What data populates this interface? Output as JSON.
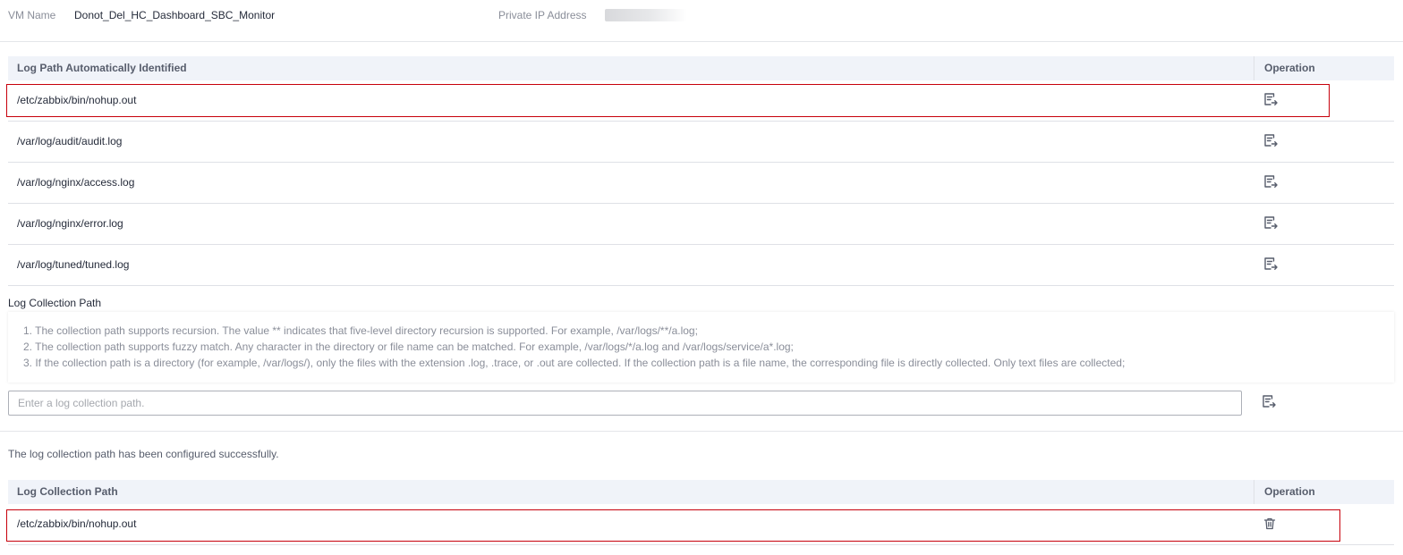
{
  "vm_info": {
    "vm_name_label": "VM Name",
    "vm_name_value": "Donot_Del_HC_Dashboard_SBC_Monitor",
    "private_ip_label": "Private IP Address"
  },
  "identified_table": {
    "headers": {
      "path": "Log Path Automatically Identified",
      "operation": "Operation"
    },
    "rows": [
      {
        "path": "/etc/zabbix/bin/nohup.out",
        "icon": "add-to-collection-icon"
      },
      {
        "path": "/var/log/audit/audit.log",
        "icon": "add-to-collection-icon"
      },
      {
        "path": "/var/log/nginx/access.log",
        "icon": "add-to-collection-icon"
      },
      {
        "path": "/var/log/nginx/error.log",
        "icon": "add-to-collection-icon"
      },
      {
        "path": "/var/log/tuned/tuned.log",
        "icon": "add-to-collection-icon"
      }
    ]
  },
  "collection": {
    "label": "Log Collection Path",
    "tips": [
      "1. The collection path supports recursion. The value ** indicates that five-level directory recursion is supported. For example, /var/logs/**/a.log;",
      "2. The collection path supports fuzzy match. Any character in the directory or file name can be matched. For example, /var/logs/*/a.log and /var/logs/service/a*.log;",
      "3. If the collection path is a directory (for example, /var/logs/), only the files with the extension .log, .trace, or .out are collected. If the collection path is a file name, the corresponding file is directly collected. Only text files are collected;"
    ],
    "input_placeholder": "Enter a log collection path.",
    "input_value": "",
    "success_message": "The log collection path has been configured successfully."
  },
  "configured_table": {
    "headers": {
      "path": "Log Collection Path",
      "operation": "Operation"
    },
    "rows": [
      {
        "path": "/etc/zabbix/bin/nohup.out",
        "icon": "trash-icon"
      }
    ]
  },
  "colors": {
    "header_bg": "#f0f3f9",
    "highlight_border": "#c7000b",
    "icon": "#575d6c"
  }
}
